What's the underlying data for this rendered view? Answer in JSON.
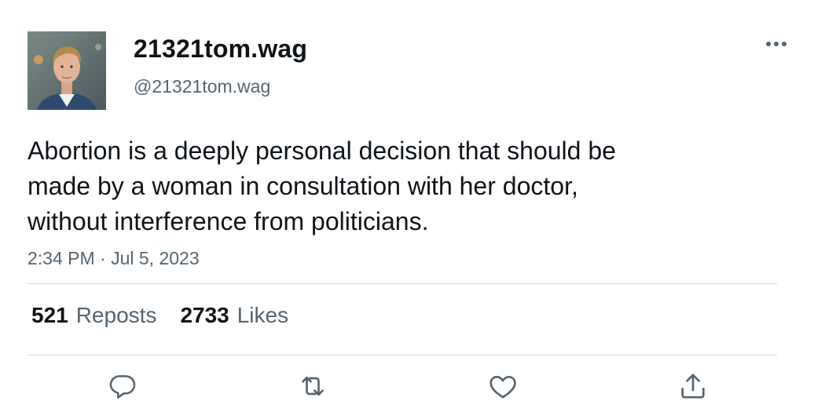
{
  "author": {
    "display_name": "21321tom.wag",
    "handle": "@21321tom.wag",
    "avatar_icon": "profile-photo"
  },
  "tweet": {
    "text": "Abortion is a deeply personal decision that should be\nmade by a woman in consultation with her doctor,\nwithout interference from politicians.",
    "timestamp": "2:34 PM · Jul 5, 2023"
  },
  "stats": {
    "reposts_count": "521",
    "reposts_label": "Reposts",
    "likes_count": "2733",
    "likes_label": "Likes"
  },
  "actions": [
    {
      "icon": "reply-icon"
    },
    {
      "icon": "repost-icon"
    },
    {
      "icon": "like-icon"
    },
    {
      "icon": "share-icon"
    }
  ],
  "colors": {
    "text": "#0f1419",
    "secondary": "#536471",
    "divider": "#cfd9de"
  }
}
